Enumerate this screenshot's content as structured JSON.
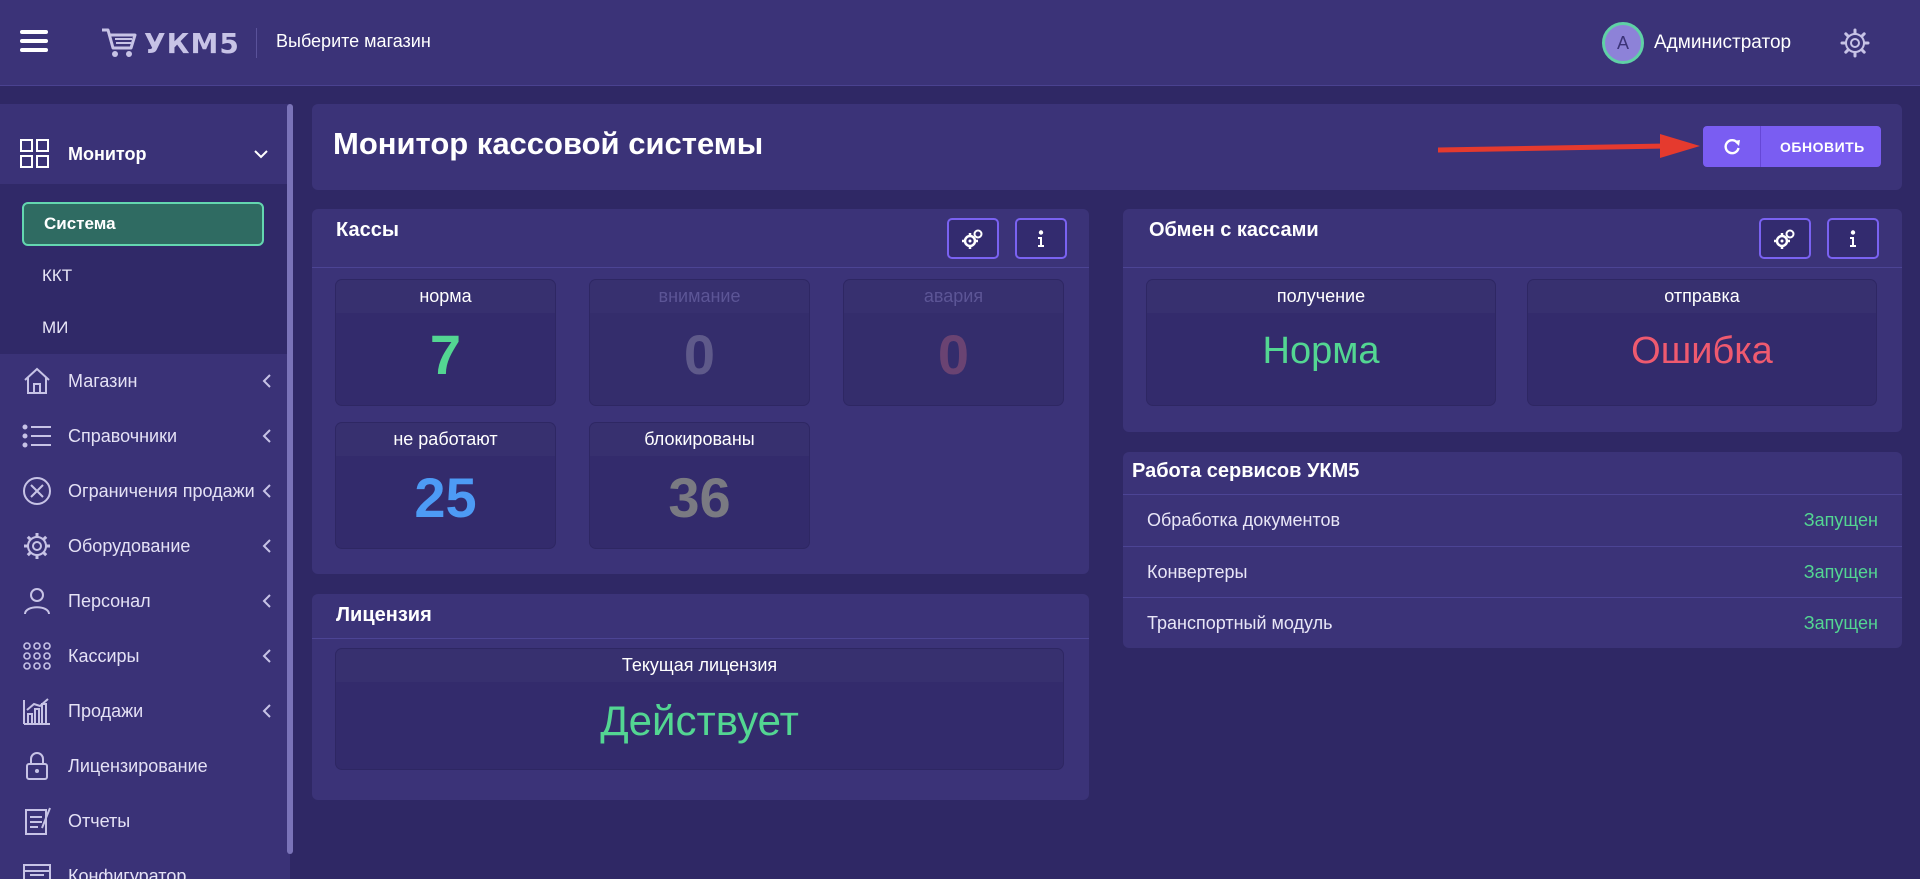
{
  "header": {
    "logo_text": "УКМ5",
    "store_select": "Выберите магазин",
    "user_initial": "А",
    "user_name": "Администратор"
  },
  "sidebar": {
    "monitor_label": "Монитор",
    "submenu": [
      "Система",
      "ККТ",
      "МИ"
    ],
    "items": [
      {
        "label": "Магазин",
        "icon": "store-icon"
      },
      {
        "label": "Справочники",
        "icon": "list-icon"
      },
      {
        "label": "Ограничения продажи",
        "icon": "restriction-icon"
      },
      {
        "label": "Оборудование",
        "icon": "gear-icon"
      },
      {
        "label": "Персонал",
        "icon": "person-icon"
      },
      {
        "label": "Кассиры",
        "icon": "grid-dots-icon"
      },
      {
        "label": "Продажи",
        "icon": "chart-icon"
      },
      {
        "label": "Лицензирование",
        "icon": "lock-icon"
      },
      {
        "label": "Отчеты",
        "icon": "report-icon"
      },
      {
        "label": "Конфигуратор",
        "icon": "window-icon"
      }
    ]
  },
  "page": {
    "title": "Монитор кассовой системы",
    "refresh_label": "ОБНОВИТЬ"
  },
  "kassy": {
    "title": "Кассы",
    "stats": [
      {
        "label": "норма",
        "value": "7",
        "color": "#53d692"
      },
      {
        "label": "внимание",
        "value": "0",
        "color": "#5f5a8a"
      },
      {
        "label": "авария",
        "value": "0",
        "color": "#6a4372"
      },
      {
        "label": "не работают",
        "value": "25",
        "color": "#4d9bf5"
      },
      {
        "label": "блокированы",
        "value": "36",
        "color": "#7a7a82"
      }
    ]
  },
  "license": {
    "title": "Лицензия",
    "label": "Текущая лицензия",
    "value": "Действует",
    "color": "#53d692"
  },
  "exchange": {
    "title": "Обмен с кассами",
    "receive_label": "получение",
    "receive_value": "Норма",
    "receive_color": "#53d692",
    "send_label": "отправка",
    "send_value": "Ошибка",
    "send_color": "#ef5a6f"
  },
  "services": {
    "title": "Работа сервисов УКМ5",
    "rows": [
      {
        "name": "Обработка документов",
        "status": "Запущен"
      },
      {
        "name": "Конвертеры",
        "status": "Запущен"
      },
      {
        "name": "Транспортный модуль",
        "status": "Запущен"
      }
    ]
  }
}
